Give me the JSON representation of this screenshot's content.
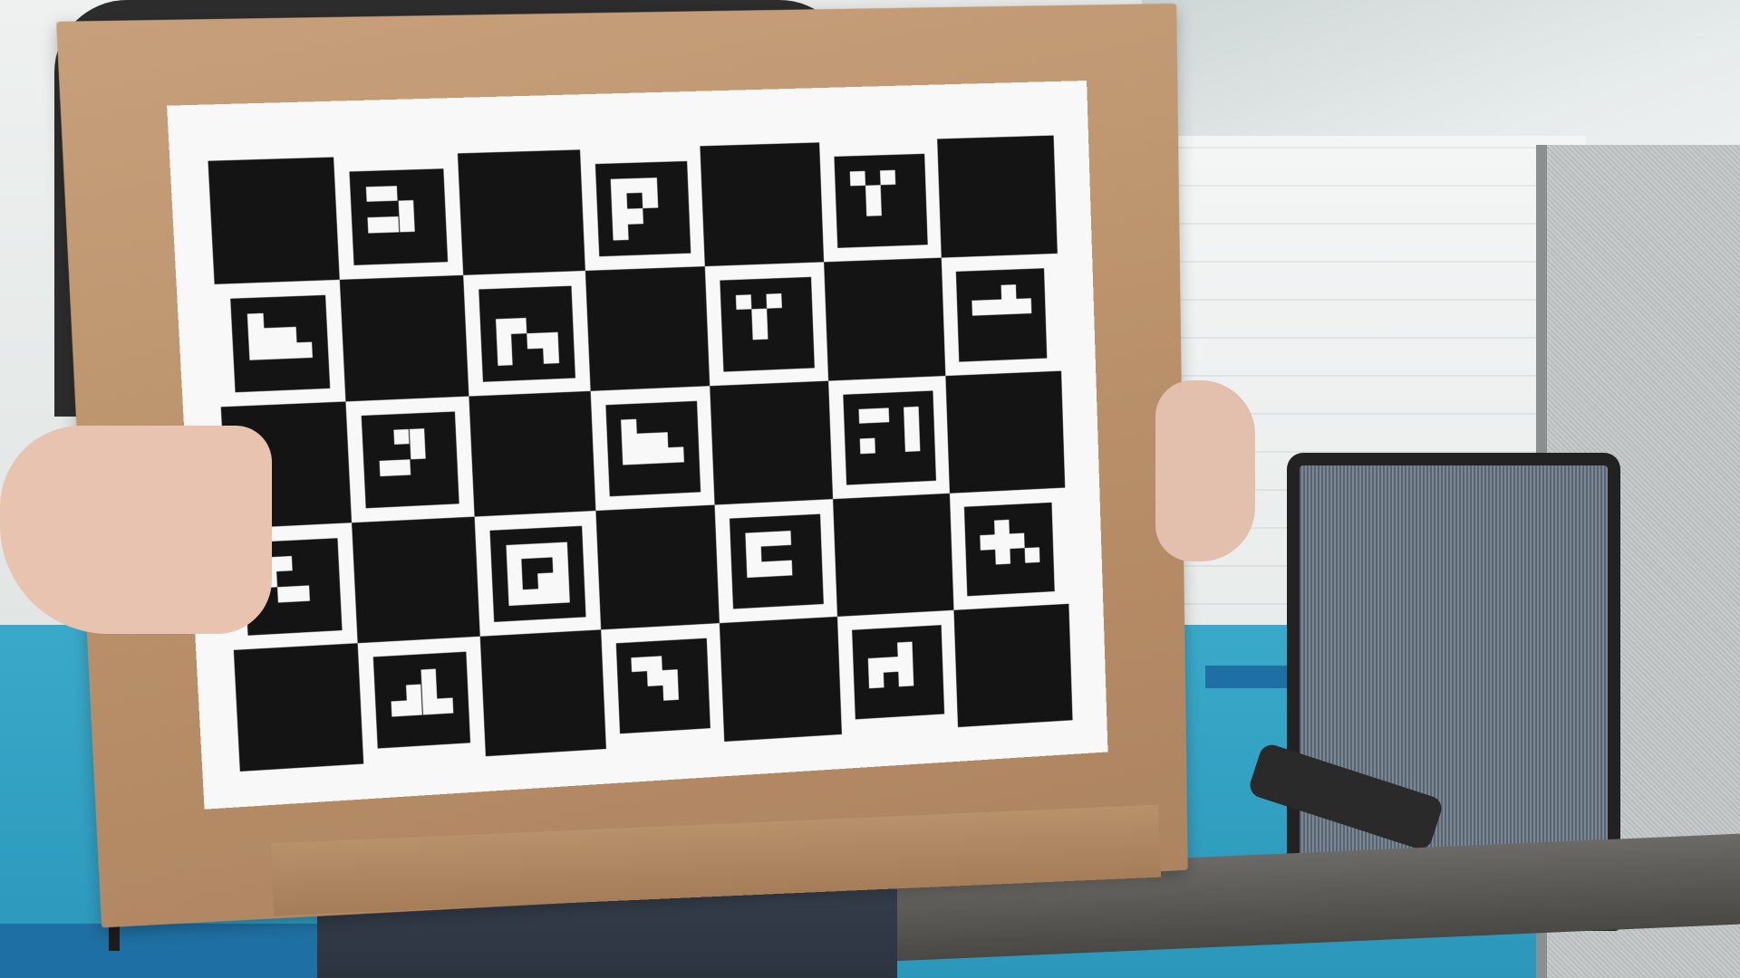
{
  "scene": {
    "description_free": true,
    "colors": {
      "cardboard": "#c7a07b",
      "paper": "#f7f8f7",
      "board_black": "#141414",
      "floor_blue": "#3aa9c9",
      "floor_dark_blue": "#1e6fa3"
    }
  },
  "charuco_board": {
    "columns": 7,
    "rows": 5,
    "first_square": "black",
    "marker_count": 17
  }
}
